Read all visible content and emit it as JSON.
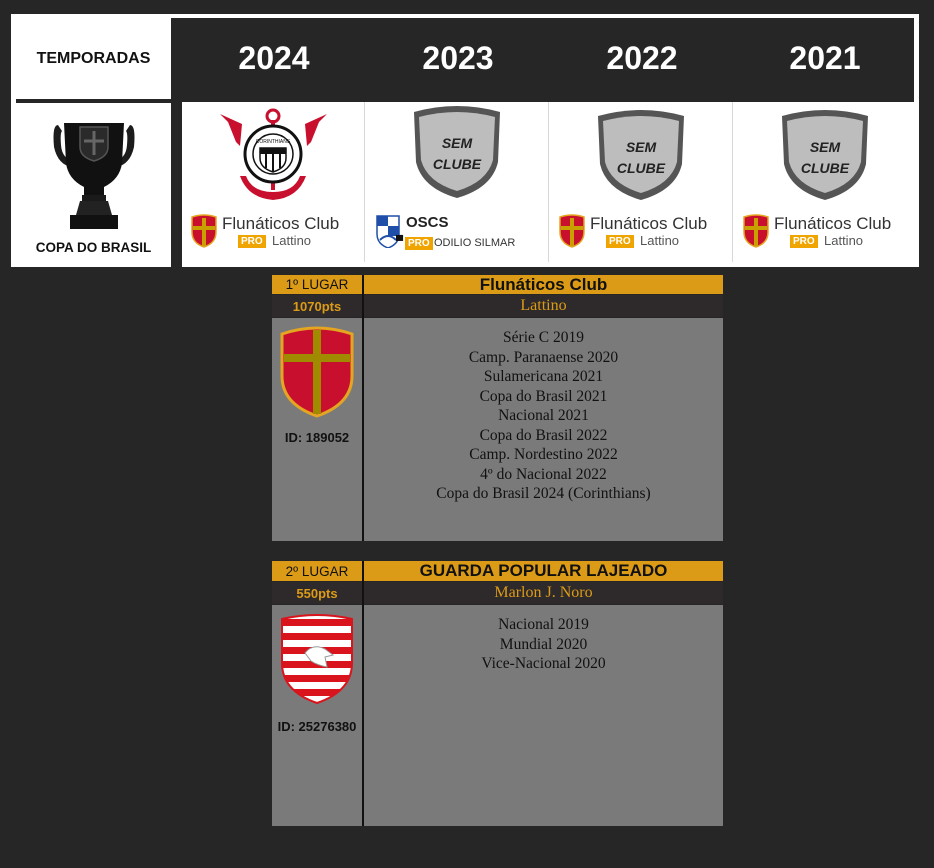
{
  "header": {
    "label": "TEMPORADAS",
    "competition": "COPA DO BRASIL",
    "years": [
      "2024",
      "2023",
      "2022",
      "2021"
    ]
  },
  "champions": [
    {
      "year": "2024",
      "badge": "corinthians-badge",
      "club": "Flunáticos Club",
      "pro": "PRO",
      "manager": "Lattino",
      "logo": "flunaticos-shield"
    },
    {
      "year": "2023",
      "badge": "sem-clube-badge",
      "badge_text": [
        "SEM",
        "CLUBE"
      ],
      "club": "OSCS",
      "pro": "PRO",
      "manager": "ODILIO SILMAR",
      "logo": "oscs-shield"
    },
    {
      "year": "2022",
      "badge": "sem-clube-badge",
      "badge_text": [
        "SEM",
        "CLUBE"
      ],
      "club": "Flunáticos Club",
      "pro": "PRO",
      "manager": "Lattino",
      "logo": "flunaticos-shield"
    },
    {
      "year": "2021",
      "badge": "sem-clube-badge",
      "badge_text": [
        "SEM",
        "CLUBE"
      ],
      "club": "Flunáticos Club",
      "pro": "PRO",
      "manager": "Lattino",
      "logo": "flunaticos-shield"
    }
  ],
  "ranking": [
    {
      "place": "1º LUGAR",
      "points": "1070pts",
      "team": "Flunáticos Club",
      "manager": "Lattino",
      "id": "ID: 189052",
      "titles": [
        "Série C 2019",
        "Camp. Paranaense 2020",
        "Sulamericana 2021",
        "Copa do Brasil 2021",
        "Nacional 2021",
        "Copa do Brasil 2022",
        "Camp. Nordestino 2022",
        "4º do Nacional 2022",
        "Copa do Brasil 2024 (Corinthians)"
      ]
    },
    {
      "place": "2º LUGAR",
      "points": "550pts",
      "team": "GUARDA POPULAR LAJEADO",
      "manager": "Marlon J. Noro",
      "id": "ID: 25276380",
      "titles": [
        "Nacional 2019",
        "Mundial 2020",
        "Vice-Nacional 2020"
      ]
    }
  ],
  "colors": {
    "background": "#262626",
    "gold": "#dc9b16",
    "panel_gray": "#7a7a7a",
    "pro_orange": "#f0a400"
  }
}
